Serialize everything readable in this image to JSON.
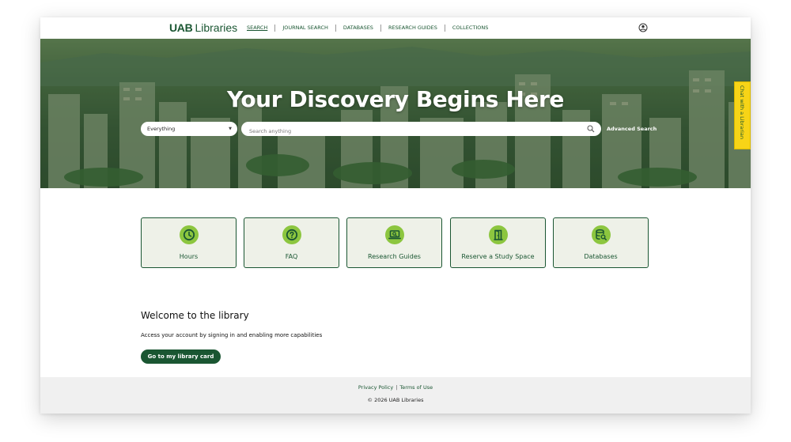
{
  "header": {
    "logo_bold": "UAB",
    "logo_text": "Libraries",
    "nav": [
      {
        "label": "SEARCH"
      },
      {
        "label": "JOURNAL SEARCH"
      },
      {
        "label": "DATABASES"
      },
      {
        "label": "RESEARCH GUIDES"
      },
      {
        "label": "COLLECTIONS"
      }
    ],
    "active_nav": "SEARCH",
    "user_icon": "user-circle-icon"
  },
  "hero": {
    "title": "Your Discovery Begins Here",
    "scope_value": "Everything",
    "search_placeholder": "Search anything",
    "advanced_search": "Advanced Search",
    "chat_tab": "Chat with a Librarian"
  },
  "tiles": [
    {
      "label": "Hours",
      "icon": "clock-icon"
    },
    {
      "label": "FAQ",
      "icon": "question-icon"
    },
    {
      "label": "Research Guides",
      "icon": "laptop-guide-icon"
    },
    {
      "label": "Reserve a Study Space",
      "icon": "door-icon"
    },
    {
      "label": "Databases",
      "icon": "database-search-icon"
    }
  ],
  "welcome": {
    "title": "Welcome to the library",
    "text": "Access your account by signing in and enabling more capabilities",
    "button": "Go to my library card"
  },
  "footer": {
    "privacy": "Privacy Policy",
    "separator": "|",
    "terms": "Terms of Use",
    "copyright": "© 2026 UAB Libraries"
  },
  "colors": {
    "brand_green": "#1a5632",
    "accent_lime": "#8cc63f",
    "chat_yellow": "#f7d417",
    "tile_bg": "#eef1e8"
  }
}
